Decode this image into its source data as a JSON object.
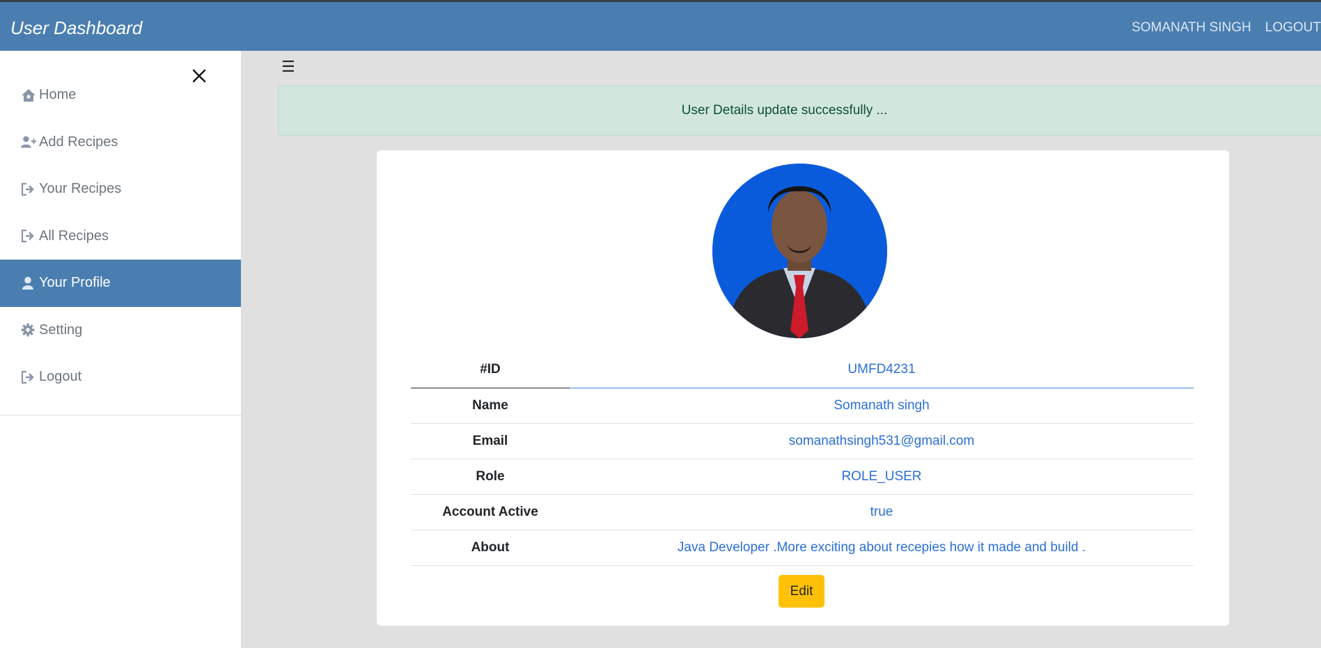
{
  "header": {
    "brand": "User Dashboard",
    "user_name": "SOMANATH SINGH",
    "logout": "LOGOUT"
  },
  "sidebar": {
    "close_icon": "close-icon",
    "items": [
      {
        "label": "Home",
        "icon": "home-icon",
        "active": false
      },
      {
        "label": "Add Recipes",
        "icon": "user-plus-icon",
        "active": false
      },
      {
        "label": "Your Recipes",
        "icon": "sign-out-icon",
        "active": false
      },
      {
        "label": "All Recipes",
        "icon": "sign-out-icon",
        "active": false
      },
      {
        "label": "Your Profile",
        "icon": "user-icon",
        "active": true
      },
      {
        "label": "Setting",
        "icon": "gear-icon",
        "active": false
      },
      {
        "label": "Logout",
        "icon": "sign-out-icon",
        "active": false
      }
    ]
  },
  "main": {
    "toggle_icon": "hamburger-icon",
    "alert": "User Details update successfully ...",
    "profile": {
      "rows": [
        {
          "label": "#ID",
          "value": "UMFD4231"
        },
        {
          "label": "Name",
          "value": "Somanath singh"
        },
        {
          "label": "Email",
          "value": "somanathsingh531@gmail.com"
        },
        {
          "label": "Role",
          "value": "ROLE_USER"
        },
        {
          "label": "Account Active",
          "value": "true"
        },
        {
          "label": "About",
          "value": "Java Developer .More exciting about recepies how it made and build ."
        }
      ],
      "edit_label": "Edit"
    }
  },
  "colors": {
    "primary": "#4a7eb0",
    "alert_bg": "#d1e7dd",
    "alert_text": "#0f5132",
    "value_text": "#2b6fd6",
    "edit_button": "#ffc107",
    "avatar_bg": "#0a5bdc"
  }
}
